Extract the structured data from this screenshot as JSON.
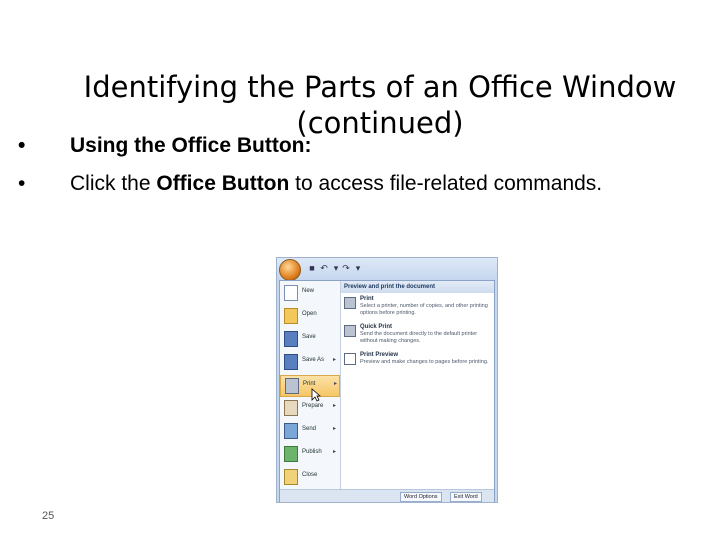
{
  "slide": {
    "title_line1": "Identifying the Parts of an Office Window",
    "title_line2": "(continued)",
    "bullets": [
      {
        "text": "Using the Office Button:"
      },
      {
        "text_pre": "Click the ",
        "text_bold": "Office Button",
        "text_post": " to access file-related commands."
      }
    ],
    "slide_number": "25"
  },
  "office_window": {
    "menu_items": [
      {
        "label": "New",
        "icon": "new-document-icon",
        "has_submenu": false
      },
      {
        "label": "Open",
        "icon": "folder-icon",
        "has_submenu": false
      },
      {
        "label": "Save",
        "icon": "disk-icon",
        "has_submenu": false
      },
      {
        "label": "Save As",
        "icon": "save-as-icon",
        "has_submenu": true
      },
      {
        "label": "Print",
        "icon": "printer-icon",
        "has_submenu": true,
        "selected": true
      },
      {
        "label": "Prepare",
        "icon": "pen-icon",
        "has_submenu": true
      },
      {
        "label": "Send",
        "icon": "send-icon",
        "has_submenu": true
      },
      {
        "label": "Publish",
        "icon": "publish-icon",
        "has_submenu": true
      },
      {
        "label": "Close",
        "icon": "close-folder-icon",
        "has_submenu": false
      }
    ],
    "submenu_heading": "Preview and print the document",
    "submenu_options": [
      {
        "title": "Print",
        "desc": "Select a printer, number of copies, and other printing options before printing."
      },
      {
        "title": "Quick Print",
        "desc": "Send the document directly to the default printer without making changes."
      },
      {
        "title": "Print Preview",
        "desc": "Preview and make changes to pages before printing."
      }
    ],
    "footer_buttons": {
      "options": "Word Options",
      "exit": "Exit Word"
    }
  }
}
